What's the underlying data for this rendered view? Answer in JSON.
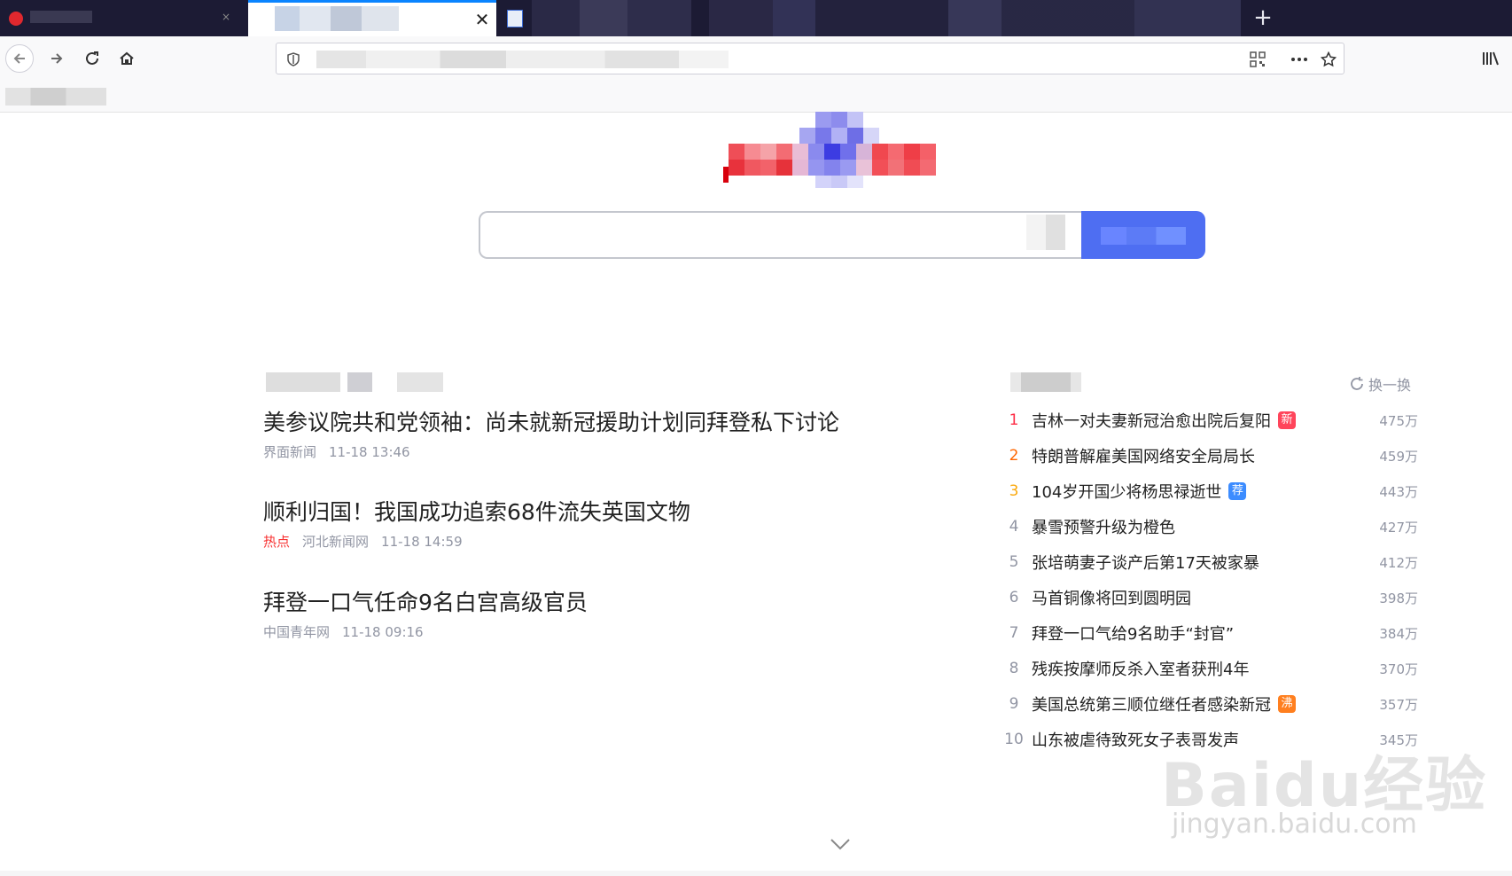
{
  "browser": {
    "active_tab_close": "✕",
    "new_tab_label": "+",
    "icons": [
      "back-icon",
      "forward-icon",
      "reload-icon",
      "home-icon",
      "shield-icon",
      "qr-code-icon",
      "more-icon",
      "bookmark-star-icon",
      "library-icon"
    ]
  },
  "search": {
    "button_color": "#4e6ef2"
  },
  "news": {
    "items": [
      {
        "title": "美参议院共和党领袖：尚未就新冠援助计划同拜登私下讨论",
        "tag": "",
        "source": "界面新闻",
        "time": "11-18 13:46"
      },
      {
        "title": "顺利归国！我国成功追索68件流失英国文物",
        "tag": "热点",
        "source": "河北新闻网",
        "time": "11-18 14:59"
      },
      {
        "title": "拜登一口气任命9名白宫高级官员",
        "tag": "",
        "source": "中国青年网",
        "time": "11-18 09:16"
      }
    ]
  },
  "hot": {
    "refresh_label": "换一换",
    "items": [
      {
        "rank": "1",
        "text": "吉林一对夫妻新冠治愈出院后复阳",
        "tag": "新",
        "tag_color": "#ff455b",
        "count": "475万"
      },
      {
        "rank": "2",
        "text": "特朗普解雇美国网络安全局局长",
        "tag": "",
        "tag_color": "",
        "count": "459万"
      },
      {
        "rank": "3",
        "text": "104岁开国少将杨思禄逝世",
        "tag": "荐",
        "tag_color": "#3c8cff",
        "count": "443万"
      },
      {
        "rank": "4",
        "text": "暴雪预警升级为橙色",
        "tag": "",
        "tag_color": "",
        "count": "427万"
      },
      {
        "rank": "5",
        "text": "张培萌妻子谈产后第17天被家暴",
        "tag": "",
        "tag_color": "",
        "count": "412万"
      },
      {
        "rank": "6",
        "text": "马首铜像将回到圆明园",
        "tag": "",
        "tag_color": "",
        "count": "398万"
      },
      {
        "rank": "7",
        "text": "拜登一口气给9名助手“封官”",
        "tag": "",
        "tag_color": "",
        "count": "384万"
      },
      {
        "rank": "8",
        "text": "残疾按摩师反杀入室者获刑4年",
        "tag": "",
        "tag_color": "",
        "count": "370万"
      },
      {
        "rank": "9",
        "text": "美国总统第三顺位继任者感染新冠",
        "tag": "沸",
        "tag_color": "#ff7f1f",
        "count": "357万"
      },
      {
        "rank": "10",
        "text": "山东被虐待致死女子表哥发声",
        "tag": "",
        "tag_color": "",
        "count": "345万"
      }
    ]
  },
  "watermark": {
    "brand": "Baidu经验",
    "url": "jingyan.baidu.com"
  }
}
